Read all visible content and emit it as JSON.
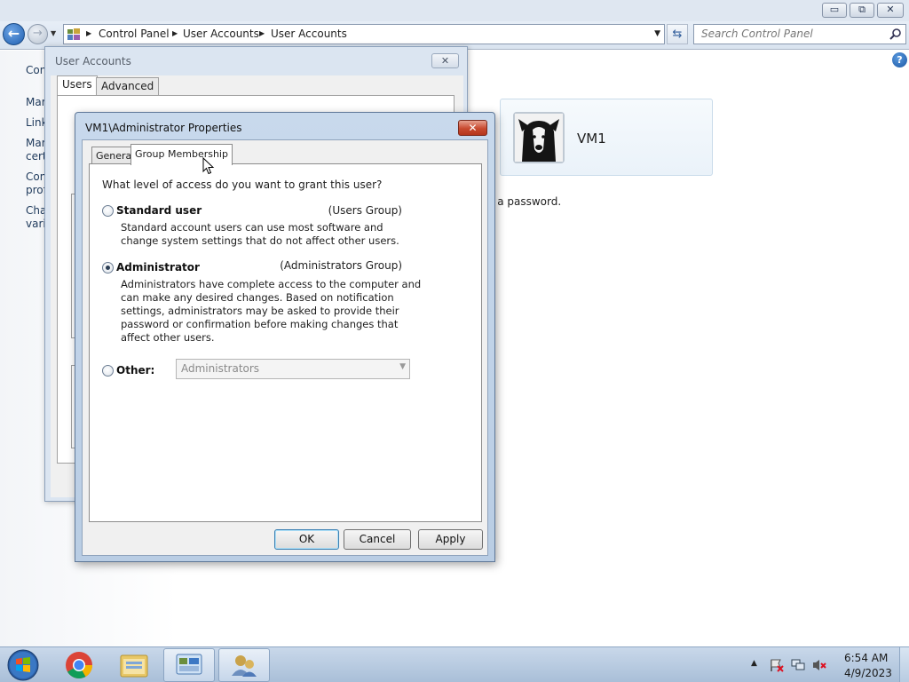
{
  "window": {
    "caption_buttons": {
      "minimize": "▭",
      "maximize": "⧉",
      "close": "✕"
    }
  },
  "nav": {
    "breadcrumbs": [
      "Control Panel",
      "User Accounts",
      "User Accounts"
    ],
    "search_placeholder": "Search Control Panel"
  },
  "control_panel": {
    "left_fragments": [
      "Con",
      "Mar",
      "Link",
      "Mar",
      "cert",
      "Con",
      "prof",
      "Cha",
      "varia"
    ],
    "user_name": "VM1",
    "password_text": "e a password.",
    "help_label": "?"
  },
  "user_accounts_dialog": {
    "title": "User Accounts",
    "close_label": "✕",
    "tabs": [
      "Users",
      "Advanced"
    ],
    "fragment": "U"
  },
  "properties_dialog": {
    "title": "VM1\\Administrator Properties",
    "close_label": "✕",
    "tabs": [
      "General",
      "Group Membership"
    ],
    "question": "What level of access do you want to grant this user?",
    "options": [
      {
        "label": "Standard user",
        "group": "(Users Group)",
        "description": "Standard account users can use most software and change system settings that do not affect other users.",
        "checked": false
      },
      {
        "label": "Administrator",
        "group": "(Administrators Group)",
        "description": "Administrators have complete access to the computer and can make any desired changes. Based on notification settings, administrators may be asked to provide their password or confirmation before making changes that affect other users.",
        "checked": true
      },
      {
        "label": "Other:",
        "checked": false
      }
    ],
    "other_select_value": "Administrators",
    "buttons": {
      "ok": "OK",
      "cancel": "Cancel",
      "apply": "Apply"
    }
  },
  "taskbar": {
    "items": [
      "start-orb",
      "chrome-icon",
      "file-explorer-icon",
      "control-panel-icon",
      "user-accounts-icon"
    ],
    "clock_time": "6:54 AM",
    "clock_date": "4/9/2023"
  },
  "colors": {
    "accent": "#1f5fb0",
    "close_red": "#c84a2f",
    "taskbar": "#b9cde2"
  }
}
